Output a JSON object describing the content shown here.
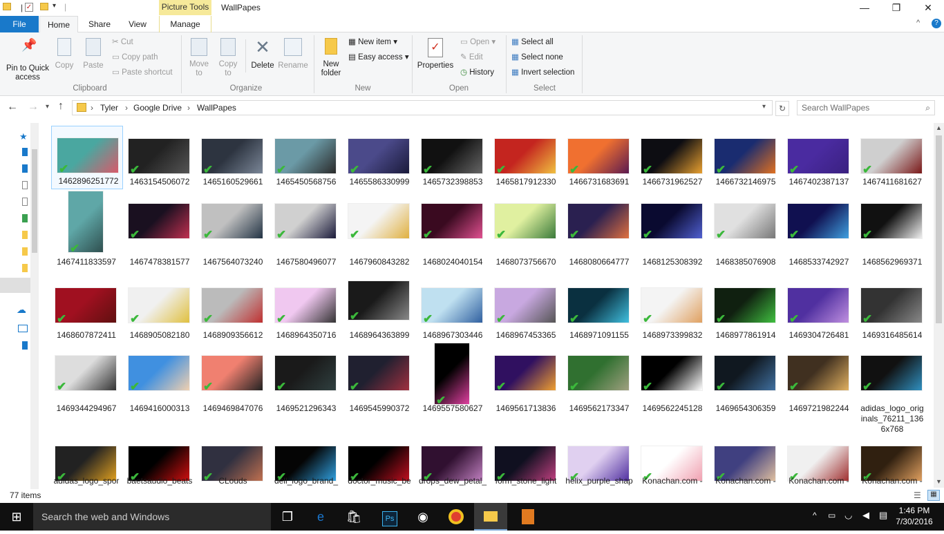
{
  "window": {
    "title": "WallPapes",
    "context_header": "Picture Tools"
  },
  "tabs": {
    "file": "File",
    "home": "Home",
    "share": "Share",
    "view": "View",
    "manage": "Manage"
  },
  "ribbon": {
    "pin": "Pin to Quick access",
    "copy": "Copy",
    "paste": "Paste",
    "cut": "Cut",
    "copy_path": "Copy path",
    "paste_shortcut": "Paste shortcut",
    "clipboard_group": "Clipboard",
    "move_to": "Move to",
    "copy_to": "Copy to",
    "delete": "Delete",
    "rename": "Rename",
    "organize_group": "Organize",
    "new_folder": "New folder",
    "new_item": "New item",
    "easy_access": "Easy access",
    "new_group": "New",
    "properties": "Properties",
    "open": "Open",
    "edit": "Edit",
    "history": "History",
    "open_group": "Open",
    "select_all": "Select all",
    "select_none": "Select none",
    "invert_selection": "Invert selection",
    "select_group": "Select"
  },
  "address": {
    "crumbs": [
      "Tyler",
      "Google Drive",
      "WallPapes"
    ],
    "search_placeholder": "Search WallPapes"
  },
  "files": [
    {
      "name": "1462896251772",
      "c1": "#4aa7a0",
      "c2": "#d85a6a"
    },
    {
      "name": "1463154506072",
      "c1": "#222222",
      "c2": "#555555"
    },
    {
      "name": "1465160529661",
      "c1": "#2d3440",
      "c2": "#7a8697"
    },
    {
      "name": "1465450568756",
      "c1": "#6b9aa6",
      "c2": "#2a2a2a"
    },
    {
      "name": "1465586330999",
      "c1": "#4b4a8a",
      "c2": "#1a1a3a"
    },
    {
      "name": "1465732398853",
      "c1": "#111111",
      "c2": "#666666"
    },
    {
      "name": "1465817912330",
      "c1": "#c4251f",
      "c2": "#f0c040"
    },
    {
      "name": "1466731683691",
      "c1": "#f07030",
      "c2": "#5a1a50"
    },
    {
      "name": "1466731962527",
      "c1": "#0d0d12",
      "c2": "#e8a030"
    },
    {
      "name": "1466732146975",
      "c1": "#1a2c70",
      "c2": "#e07020"
    },
    {
      "name": "1467402387137",
      "c1": "#4a2ba0",
      "c2": "#3a2080"
    },
    {
      "name": "1467411681627",
      "c1": "#cfcfcf",
      "c2": "#7a1818"
    },
    {
      "name": "1467411833597",
      "c1": "#5fa7a7",
      "c2": "#2f4f4f"
    },
    {
      "name": "1467478381577",
      "c1": "#1a1020",
      "c2": "#c03050"
    },
    {
      "name": "1467564073240",
      "c1": "#c0c0c0",
      "c2": "#223344"
    },
    {
      "name": "1467580496077",
      "c1": "#d0d0d0",
      "c2": "#1a1a3a"
    },
    {
      "name": "1467960843282",
      "c1": "#f4f4f4",
      "c2": "#e0b040"
    },
    {
      "name": "1468024040154",
      "c1": "#3a0a20",
      "c2": "#e05090"
    },
    {
      "name": "1468073756670",
      "c1": "#e0f0a0",
      "c2": "#3a7a3a"
    },
    {
      "name": "1468080664777",
      "c1": "#2a2050",
      "c2": "#e07040"
    },
    {
      "name": "1468125308392",
      "c1": "#0a0a30",
      "c2": "#5060d0"
    },
    {
      "name": "1468385076908",
      "c1": "#e0e0e0",
      "c2": "#777777"
    },
    {
      "name": "1468533742927",
      "c1": "#101050",
      "c2": "#40a0e0"
    },
    {
      "name": "1468562969371",
      "c1": "#111111",
      "c2": "#f0f0f0"
    },
    {
      "name": "1468607872411",
      "c1": "#a01020",
      "c2": "#601010"
    },
    {
      "name": "1468905082180",
      "c1": "#f0f0f0",
      "c2": "#e0c040"
    },
    {
      "name": "1468909356612",
      "c1": "#bbbbbb",
      "c2": "#c03030"
    },
    {
      "name": "1468964350716",
      "c1": "#f0c8f0",
      "c2": "#333333"
    },
    {
      "name": "1468964363899",
      "c1": "#1a1a1a",
      "c2": "#888888"
    },
    {
      "name": "1468967303446",
      "c1": "#bfe0f0",
      "c2": "#3060a0"
    },
    {
      "name": "1468967453365",
      "c1": "#c8a8e0",
      "c2": "#555555"
    },
    {
      "name": "1468971091155",
      "c1": "#0a3040",
      "c2": "#40c0e0"
    },
    {
      "name": "1468973399832",
      "c1": "#f4f4f4",
      "c2": "#e0a060"
    },
    {
      "name": "1468977861914",
      "c1": "#102010",
      "c2": "#40c040"
    },
    {
      "name": "1469304726481",
      "c1": "#5030a0",
      "c2": "#c090e0"
    },
    {
      "name": "1469316485614",
      "c1": "#333333",
      "c2": "#888888"
    },
    {
      "name": "1469344294967",
      "c1": "#dddddd",
      "c2": "#333333"
    },
    {
      "name": "1469416000313",
      "c1": "#4090e0",
      "c2": "#f0d0b0"
    },
    {
      "name": "1469469847076",
      "c1": "#f08070",
      "c2": "#222222"
    },
    {
      "name": "1469521296343",
      "c1": "#1a1a1a",
      "c2": "#304040"
    },
    {
      "name": "1469545990372",
      "c1": "#202030",
      "c2": "#a03040"
    },
    {
      "name": "1469557580627",
      "c1": "#000000",
      "c2": "#e040a0"
    },
    {
      "name": "1469561713836",
      "c1": "#301060",
      "c2": "#f0a030"
    },
    {
      "name": "1469562173347",
      "c1": "#307030",
      "c2": "#a0a080"
    },
    {
      "name": "1469562245128",
      "c1": "#000000",
      "c2": "#ffffff"
    },
    {
      "name": "1469654306359",
      "c1": "#101820",
      "c2": "#4070a0"
    },
    {
      "name": "1469721982244",
      "c1": "#403020",
      "c2": "#e0b060"
    },
    {
      "name": "adidas_logo_originals_76211_1366x768",
      "c1": "#111111",
      "c2": "#3090c0"
    },
    {
      "name": "adidas_logo_spor",
      "c1": "#222222",
      "c2": "#e0a020"
    },
    {
      "name": "baetsaudio_beats",
      "c1": "#000000",
      "c2": "#d01010"
    },
    {
      "name": "CLouds",
      "c1": "#303040",
      "c2": "#c07050"
    },
    {
      "name": "dell_logo_brand_",
      "c1": "#050505",
      "c2": "#30a0e0"
    },
    {
      "name": "doctor_music_be",
      "c1": "#000000",
      "c2": "#c01020"
    },
    {
      "name": "drops_dew_petal_",
      "c1": "#301030",
      "c2": "#c080c0"
    },
    {
      "name": "form_stone_light",
      "c1": "#101020",
      "c2": "#c04080"
    },
    {
      "name": "helix_purple_shap",
      "c1": "#e0d0f0",
      "c2": "#5030a0"
    },
    {
      "name": "Konachan.com -",
      "c1": "#ffffff",
      "c2": "#f0a0b0"
    },
    {
      "name": "Konachan.com -",
      "c1": "#404080",
      "c2": "#e0c0a0"
    },
    {
      "name": "Konachan.com -",
      "c1": "#f0f0f0",
      "c2": "#a03030"
    },
    {
      "name": "Konachan.com -",
      "c1": "#302010",
      "c2": "#e0a060"
    }
  ],
  "status": {
    "count": "77 items"
  },
  "taskbar": {
    "search": "Search the web and Windows",
    "time": "1:46 PM",
    "date": "7/30/2016"
  }
}
